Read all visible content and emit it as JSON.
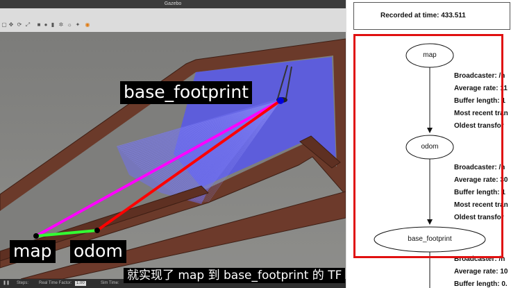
{
  "window": {
    "title": "Gazebo"
  },
  "viewport": {
    "labels": {
      "base_footprint": "base_footprint",
      "map": "map",
      "odom": "odom"
    }
  },
  "statusbar": {
    "steps": "Steps:",
    "real_time_factor": "Real Time Factor:",
    "real_time_value": "1.00",
    "sim_time": "Sim Time:"
  },
  "subtitle": "就实现了 map 到 base_footprint 的 TF",
  "tf_tree": {
    "recorded": "Recorded at time: 433.511",
    "nodes": [
      "map",
      "odom",
      "base_footprint"
    ],
    "map_info": [
      "Broadcaster: /h",
      "Average rate: 11",
      "Buffer length: 1",
      "Most recent tran",
      "Oldest transfor"
    ],
    "odom_info": [
      "Broadcaster: /h",
      "Average rate: 30",
      "Buffer length: 1",
      "Most recent tran",
      "Oldest transfor"
    ],
    "bottom_info": [
      "Broadcaster: /h",
      "Average rate: 10",
      "Buffer length: 0."
    ]
  },
  "colors": {
    "map_to_base_line": "#ff00ff",
    "odom_to_base_line": "#ff0000",
    "map_to_odom_line": "#33ff33",
    "highlight_box": "#e01010",
    "laser_scan": "#5a5ae6"
  }
}
